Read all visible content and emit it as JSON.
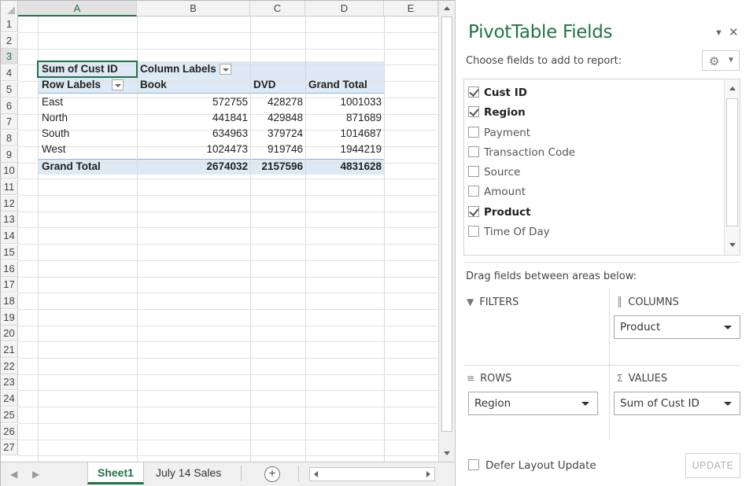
{
  "columns": [
    "A",
    "B",
    "C",
    "D",
    "E"
  ],
  "rows": [
    "1",
    "2",
    "3",
    "4",
    "5",
    "6",
    "7",
    "8",
    "9",
    "10",
    "11",
    "12",
    "13",
    "14",
    "15",
    "16",
    "17",
    "18",
    "19",
    "20",
    "21",
    "22",
    "23",
    "24",
    "25",
    "26",
    "27"
  ],
  "pivot": {
    "r3": {
      "a": "Sum of Cust ID",
      "b": "Column Labels"
    },
    "r4": {
      "a": "Row Labels",
      "b": "Book",
      "c": "DVD",
      "d": "Grand Total"
    },
    "data_rows": [
      {
        "label": "East",
        "book": "572755",
        "dvd": "428278",
        "total": "1001033"
      },
      {
        "label": "North",
        "book": "441841",
        "dvd": "429848",
        "total": "871689"
      },
      {
        "label": "South",
        "book": "634963",
        "dvd": "379724",
        "total": "1014687"
      },
      {
        "label": "West",
        "book": "1024473",
        "dvd": "919746",
        "total": "1944219"
      }
    ],
    "grand_total": {
      "label": "Grand Total",
      "book": "2674032",
      "dvd": "2157596",
      "total": "4831628"
    }
  },
  "tabs": {
    "sheet1": "Sheet1",
    "sheet2": "July 14 Sales",
    "add": "+"
  },
  "pane": {
    "title": "PivotTable Fields",
    "choose_label": "Choose fields to add to report:",
    "fields": [
      {
        "name": "Cust ID",
        "checked": true
      },
      {
        "name": "Region",
        "checked": true
      },
      {
        "name": "Payment",
        "checked": false
      },
      {
        "name": "Transaction Code",
        "checked": false
      },
      {
        "name": "Source",
        "checked": false
      },
      {
        "name": "Amount",
        "checked": false
      },
      {
        "name": "Product",
        "checked": true
      },
      {
        "name": "Time Of Day",
        "checked": false
      }
    ],
    "drag_label": "Drag fields between areas below:",
    "areas": {
      "filters": "FILTERS",
      "columns": "COLUMNS",
      "rows": "ROWS",
      "values": "VALUES",
      "columns_item": "Product",
      "rows_item": "Region",
      "values_item": "Sum of Cust ID"
    },
    "defer_label": "Defer Layout Update",
    "update_label": "UPDATE"
  }
}
